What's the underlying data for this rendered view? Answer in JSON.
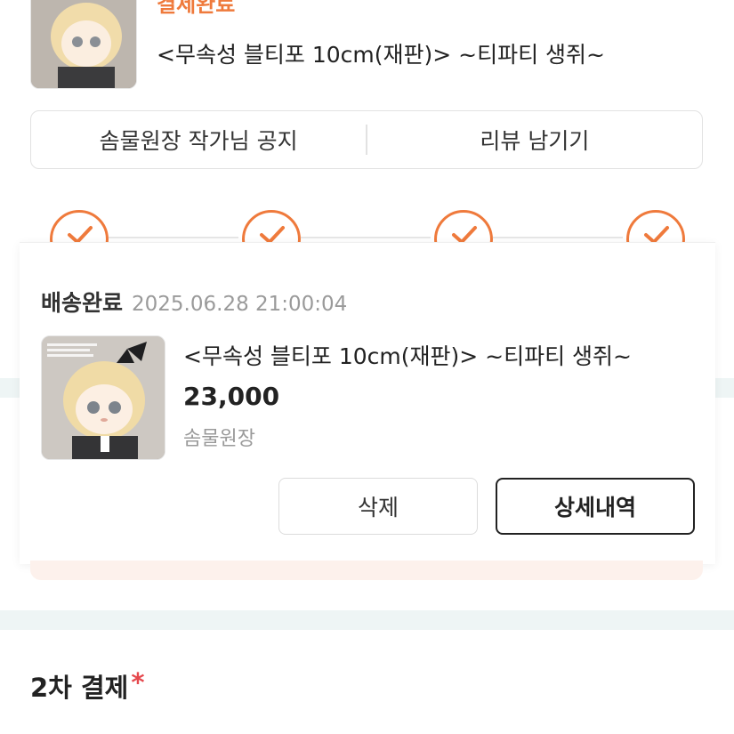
{
  "order": {
    "status": "결제완료",
    "product_title": "<무속성 블티포 10cm(재판)> ~티파티 생쥐~"
  },
  "actions": {
    "notice_label": "솜물원장 작가님 공지",
    "review_label": "리뷰 남기기"
  },
  "progress": {
    "steps_done": 4,
    "steps_total": 4
  },
  "popup": {
    "status": "배송완료",
    "date": "2025.06.28 21:00:04",
    "product_title": "<무속성 블티포 10cm(재판)> ~티파티 생쥐~",
    "price": "23,000",
    "seller": "솜물원장",
    "delete_label": "삭제",
    "detail_label": "상세내역"
  },
  "second_payment": {
    "title": "2차 결제",
    "required_mark": "*"
  },
  "colors": {
    "accent": "#ef7a3c",
    "required": "#e5484d",
    "divider": "#eef5f5"
  }
}
